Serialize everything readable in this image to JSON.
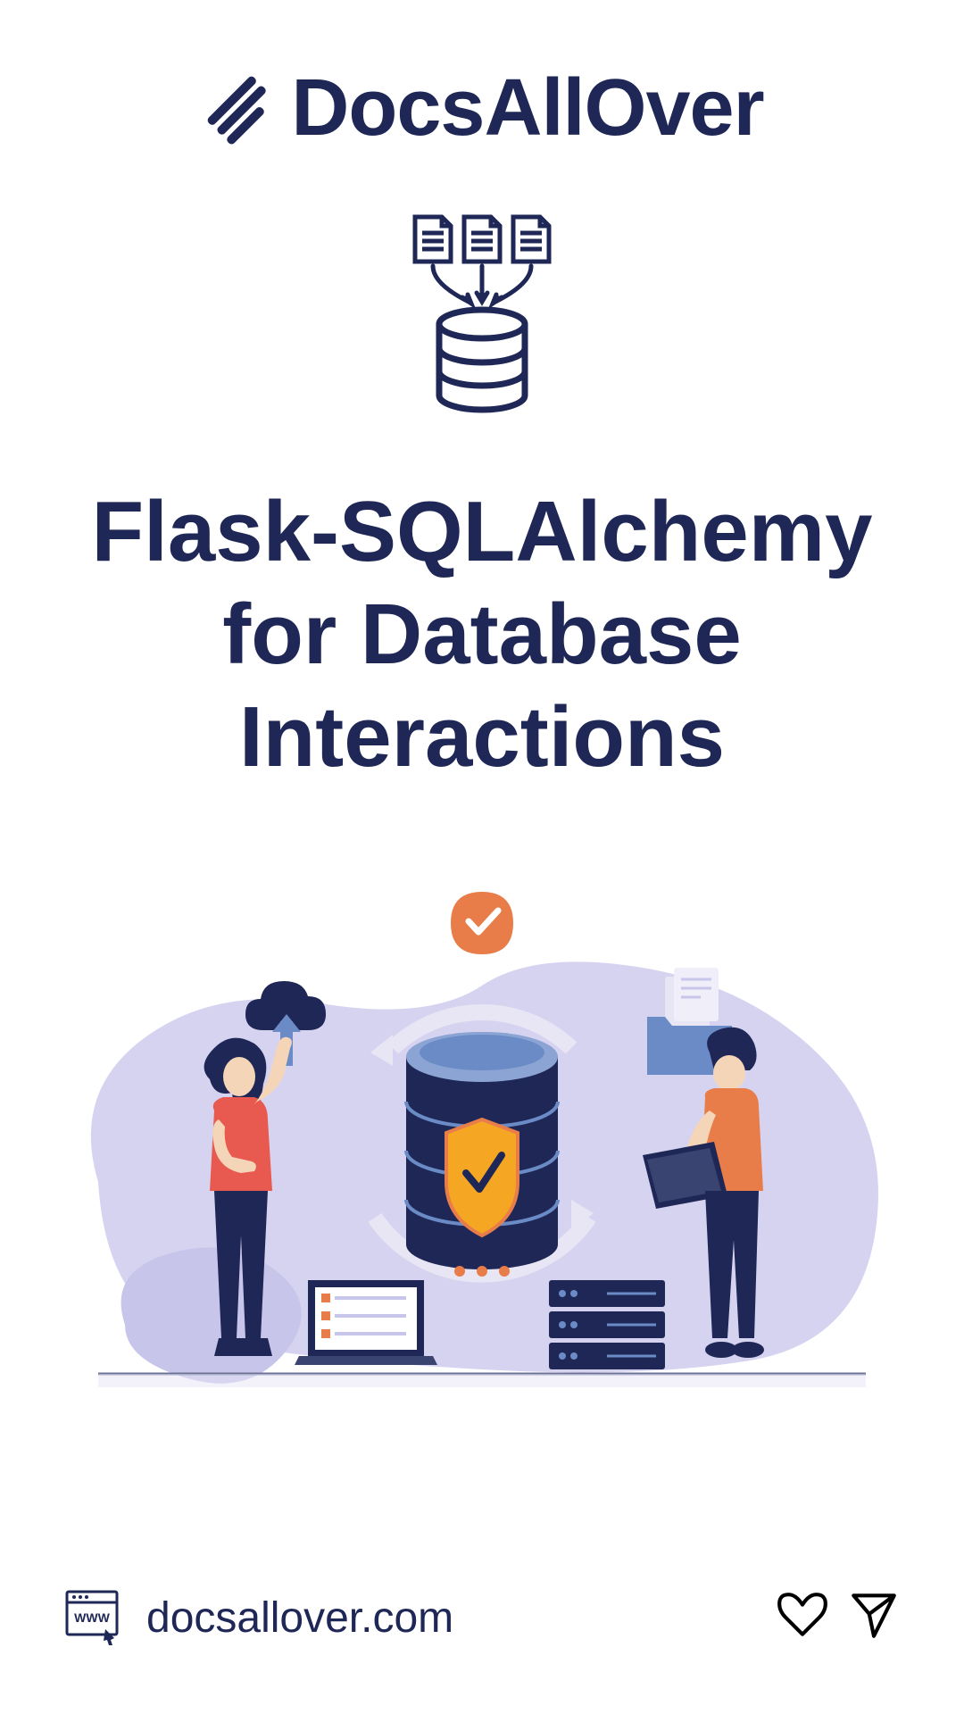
{
  "brand": {
    "name": "DocsAllOver"
  },
  "title": "Flask-SQLAlchemy for Database Interactions",
  "footer": {
    "url": "docsallover.com"
  },
  "colors": {
    "primary": "#1e2755",
    "accent_orange": "#e87d4a",
    "accent_red": "#e85a4f",
    "accent_blue": "#6b8bc7",
    "light_purple": "#d0cef0",
    "skin": "#f5d5b8"
  }
}
